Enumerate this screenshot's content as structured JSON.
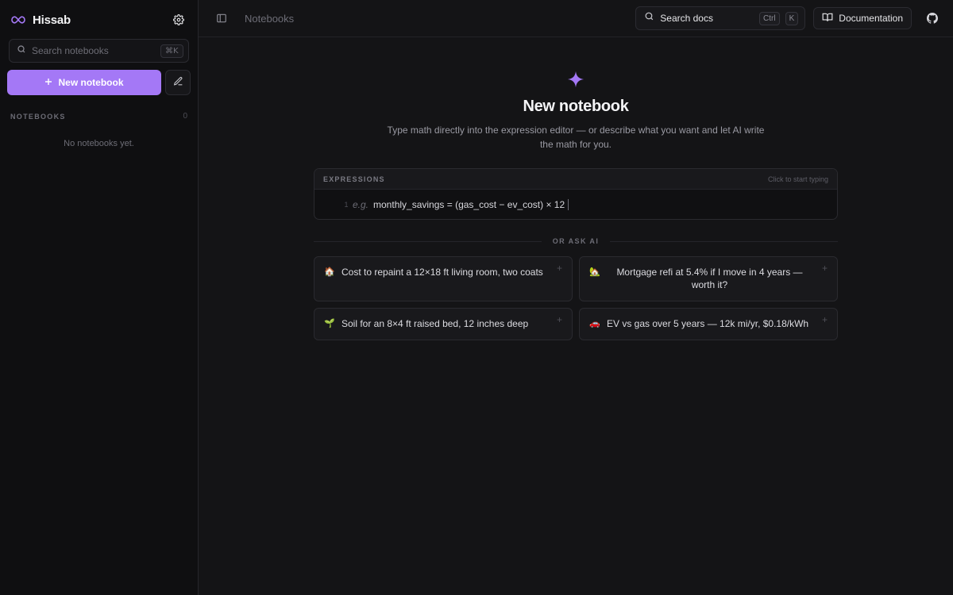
{
  "sidebar": {
    "app_name": "Hissab",
    "search_placeholder": "Search notebooks",
    "search_shortcut": "⌘K",
    "new_notebook_label": "New notebook",
    "section_title": "NOTEBOOKS",
    "section_count": "0",
    "empty_message": "No notebooks yet."
  },
  "topbar": {
    "breadcrumb": "Notebooks",
    "search_docs_label": "Search docs",
    "search_keys": [
      "Ctrl",
      "K"
    ],
    "documentation_label": "Documentation"
  },
  "hero": {
    "title": "New notebook",
    "description": "Type math directly into the expression editor — or describe what you want and let AI write the math for you."
  },
  "expressions": {
    "header": "EXPRESSIONS",
    "hint": "Click to start typing",
    "line_number": "1",
    "example_prefix": "e.g.",
    "example": "monthly_savings = (gas_cost − ev_cost) × 12"
  },
  "ask_ai": {
    "label": "OR ASK AI",
    "prompts": [
      {
        "emoji": "🏠",
        "text": "Cost to repaint a 12×18 ft living room, two coats"
      },
      {
        "emoji": "🏡",
        "text": "Mortgage refi at 5.4% if I move in 4 years — worth it?"
      },
      {
        "emoji": "🌱",
        "text": "Soil for an 8×4 ft raised bed, 12 inches deep"
      },
      {
        "emoji": "🚗",
        "text": "EV vs gas over 5 years — 12k mi/yr, $0.18/kWh"
      }
    ],
    "plus_symbol": "+"
  },
  "colors": {
    "accent": "#a478f6",
    "background": "#141416",
    "sidebar": "#0f0f11"
  }
}
